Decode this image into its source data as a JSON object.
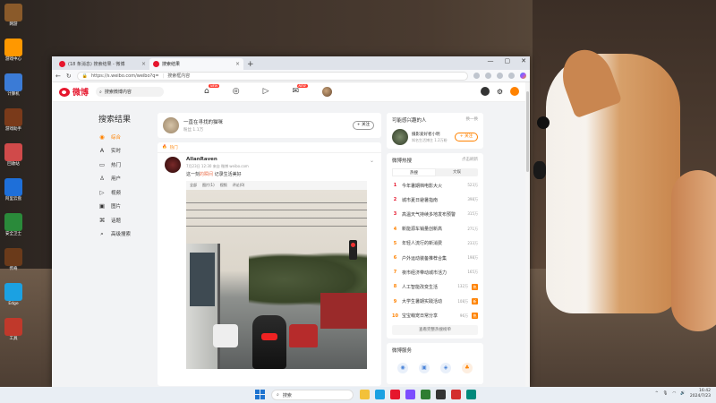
{
  "browser": {
    "tabs": [
      {
        "label": "(18 条消息) 搜索结果 - 微博",
        "active": false
      },
      {
        "label": "搜索结果",
        "active": true
      }
    ],
    "new_tab": "+",
    "url": "https://s.weibo.com/weibo?q=",
    "query": "搜索框内容"
  },
  "weibo": {
    "logo": "微博",
    "search_placeholder": "搜索微博内容",
    "nav_badge": "NEW",
    "nav_icons": [
      "home-icon",
      "discover-icon",
      "video-icon",
      "message-icon"
    ],
    "left_nav": {
      "title": "搜索结果",
      "items": [
        {
          "icon": "◉",
          "label": "综合",
          "active": true
        },
        {
          "icon": "A",
          "label": "实时",
          "active": false
        },
        {
          "icon": "▭",
          "label": "热门",
          "active": false
        },
        {
          "icon": "♙",
          "label": "用户",
          "active": false
        },
        {
          "icon": "▷",
          "label": "视频",
          "active": false
        },
        {
          "icon": "▣",
          "label": "图片",
          "active": false
        },
        {
          "icon": "⌘",
          "label": "话题",
          "active": false
        },
        {
          "icon": "⌕",
          "label": "高级搜索",
          "active": false
        }
      ]
    },
    "user_card": {
      "name": "一直在寻找的猫咪",
      "sub": "粉丝  1.1万",
      "follow": "+ 关注"
    },
    "hot_label": "热门",
    "post": {
      "author": "AllanRaven",
      "meta": "7月23日 12:30  来自 微博 weibo.com",
      "text_prefix": "这一刻",
      "text_highlight": "的瞬间",
      "text_suffix": "  记录生活美好",
      "actions": [
        "全部",
        "图片(1)",
        "视频",
        "评论(0)"
      ]
    },
    "right": {
      "recommend": {
        "title": "可能感兴趣的人",
        "more": "换一换",
        "name": "摄影爱好者小明",
        "sub": "知名生活博主  1.2万粉",
        "btn": "+ 关注"
      },
      "hot_search": {
        "title": "微博热搜",
        "refresh": "点击刷新",
        "tabs": [
          "热搜",
          "文娱"
        ],
        "items": [
          {
            "rank": "1",
            "kw": "今年暑期档电影大火",
            "cnt": "523万",
            "tag": ""
          },
          {
            "rank": "2",
            "kw": "城市夏日避暑指南",
            "cnt": "398万",
            "tag": ""
          },
          {
            "rank": "3",
            "kw": "高温天气持续多地发布预警",
            "cnt": "315万",
            "tag": ""
          },
          {
            "rank": "4",
            "kw": "新能源车销量创新高",
            "cnt": "271万",
            "tag": ""
          },
          {
            "rank": "5",
            "kw": "年轻人流行的新消费",
            "cnt": "233万",
            "tag": ""
          },
          {
            "rank": "6",
            "kw": "户外运动装备推荐合集",
            "cnt": "198万",
            "tag": ""
          },
          {
            "rank": "7",
            "kw": "夜市经济带动城市活力",
            "cnt": "165万",
            "tag": ""
          },
          {
            "rank": "8",
            "kw": "人工智能改变生活",
            "cnt": "132万",
            "tag": "热"
          },
          {
            "rank": "9",
            "kw": "大学生暑期实践活动",
            "cnt": "108万",
            "tag": "新"
          },
          {
            "rank": "10",
            "kw": "宝宝萌宠日常分享",
            "cnt": "96万",
            "tag": "热"
          }
        ],
        "more": "查看完整热搜榜单"
      },
      "services": {
        "title": "微博服务"
      }
    }
  },
  "taskbar": {
    "search": "搜索",
    "time": "16:42",
    "date": "2024/7/23"
  },
  "desktop_icons": [
    {
      "label": "网游",
      "color": "#8a5a2a"
    },
    {
      "label": "游戏中心",
      "color": "#ff9800"
    },
    {
      "label": "计算机",
      "color": "#3b7bd6"
    },
    {
      "label": "游戏助手",
      "color": "#7a3a1a"
    },
    {
      "label": "回收站",
      "color": "#d04a4a"
    },
    {
      "label": "阿里云盘",
      "color": "#1e6fd9"
    },
    {
      "label": "安全卫士",
      "color": "#2a8a3a"
    },
    {
      "label": "传奇",
      "color": "#6a3a1a"
    },
    {
      "label": "Edge",
      "color": "#1ba1e2"
    },
    {
      "label": "工具",
      "color": "#c0392b"
    }
  ]
}
